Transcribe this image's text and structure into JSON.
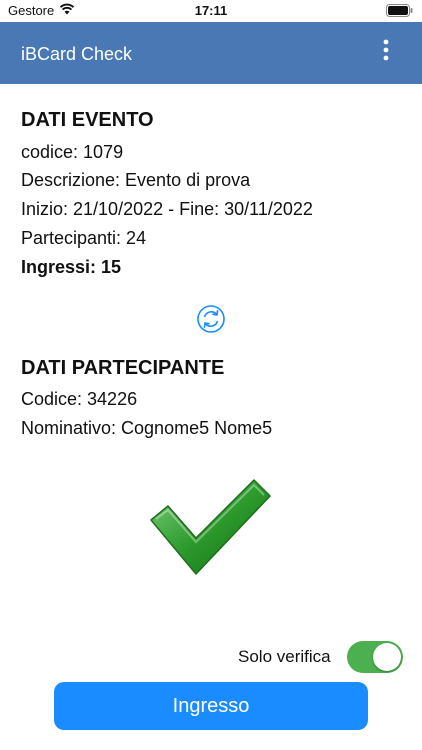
{
  "status_bar": {
    "carrier": "Gestore",
    "time": "17:11"
  },
  "app_bar": {
    "title": "iBCard Check"
  },
  "event": {
    "heading": "DATI EVENTO",
    "codice": "codice: 1079",
    "descrizione": "Descrizione: Evento di prova",
    "date_range": "Inizio: 21/10/2022 - Fine: 30/11/2022",
    "partecipanti": "Partecipanti: 24",
    "ingressi": "Ingressi: 15"
  },
  "participant": {
    "heading": "DATI PARTECIPANTE",
    "codice": "Codice: 34226",
    "nominativo": "Nominativo: Cognome5 Nome5"
  },
  "controls": {
    "toggle_label": "Solo verifica",
    "toggle_on": true,
    "button_label": "Ingresso"
  },
  "colors": {
    "app_bar": "#4a78b4",
    "toggle": "#4caf50",
    "button": "#1a8cff",
    "check": "#2e9b2e"
  },
  "icons": [
    "wifi-icon",
    "battery-icon",
    "overflow-menu-icon",
    "refresh-icon",
    "checkmark-icon"
  ]
}
